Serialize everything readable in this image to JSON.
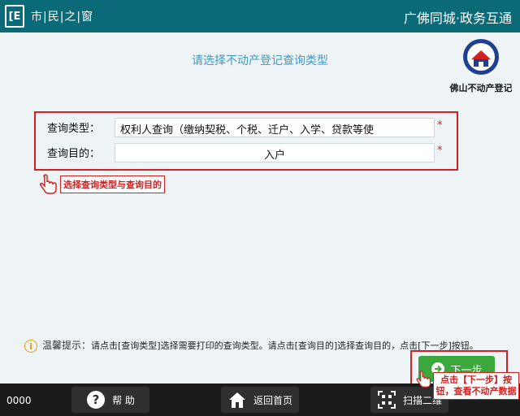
{
  "header": {
    "brand_mark": "[E",
    "brand_name": "市|民|之|窗",
    "title": "广佛同城·政务互通"
  },
  "main": {
    "heading": "请选择不动产登记查询类型",
    "logo_caption": "佛山不动产登记"
  },
  "form": {
    "query_type_label": "查询类型：",
    "query_type_value": "权利人查询（缴纳契税、个税、迁户、入学、贷款等使",
    "query_purpose_label": "查询目的：",
    "query_purpose_value": "入户",
    "required_mark": "*"
  },
  "callout": {
    "select_hint": "选择查询类型与查询目的"
  },
  "tip": {
    "title": "温馨提示：",
    "text": "请点击[查询类型]选择需要打印的查询类型。请点击[查询目的]选择查询目的，点击[下一步]按钮。"
  },
  "next": {
    "label": "下一步",
    "hint": "点击【下一步】按钮，查看不动产数据"
  },
  "footer": {
    "code": "0000",
    "help_label": "帮 助",
    "home_label": "返回首页",
    "scan_label": "扫描二维"
  },
  "colors": {
    "header_bg": "#0a6a77",
    "accent_red": "#d32020",
    "next_green": "#3aa83a",
    "heading_blue": "#3d9bc4"
  }
}
